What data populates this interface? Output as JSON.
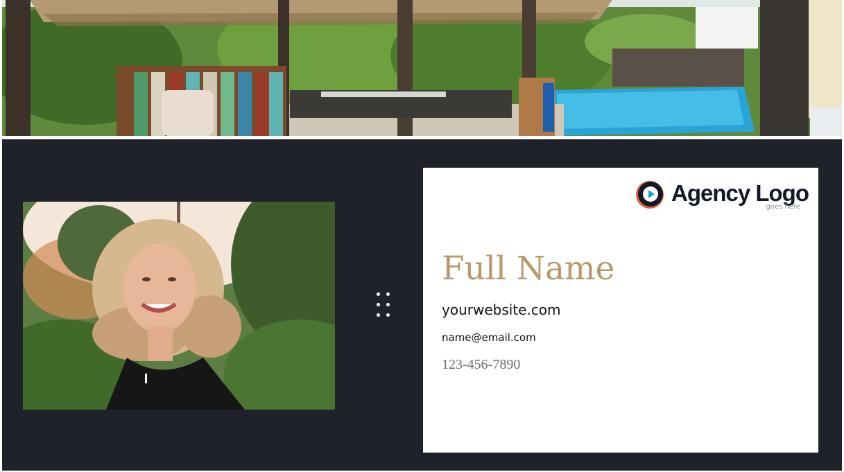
{
  "card": {
    "full_name": "Full Name",
    "website": "yourwebsite.com",
    "email": "name@email.com",
    "phone": "123-456-7890"
  },
  "logo": {
    "icon": "play-circle-icon",
    "text": "Agency Logo",
    "subtext": "goes here"
  },
  "images": {
    "banner": "tropical-patio-pool-photo",
    "portrait": "woman-portrait-photo"
  },
  "handle": {
    "icon": "drag-handle-icon"
  },
  "colors": {
    "panel_background": "#1f222a",
    "card_background": "#ffffff",
    "name_accent": "#b89a6a",
    "logo_text": "#121826",
    "logo_ring": "#e0603a",
    "logo_play": "#1aa6c9"
  }
}
